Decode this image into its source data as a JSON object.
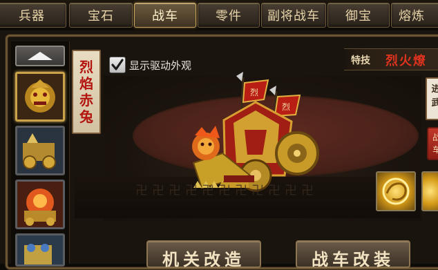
{
  "tabs": [
    {
      "label": "兵器"
    },
    {
      "label": "宝石"
    },
    {
      "label": "战车"
    },
    {
      "label": "零件"
    },
    {
      "label": "副将战车"
    },
    {
      "label": "御宝"
    },
    {
      "label": "熔炼"
    }
  ],
  "active_tab": "战车",
  "vehicle_name": [
    "烈",
    "焰",
    "赤",
    "兔"
  ],
  "show_drive_appearance": {
    "checked": true,
    "label": "显示驱动外观"
  },
  "skill": {
    "label": "特技",
    "name": "烈火燎"
  },
  "side_card": {
    "line1": "进",
    "line2": "武"
  },
  "side_red": {
    "line1": "战",
    "line2": "车"
  },
  "banner_text": "烈",
  "buttons": {
    "left": "机关改造",
    "right": "战车改装"
  },
  "icons": {
    "scroll": "scroll-up-arrow-icon",
    "check": "checkmark-icon",
    "gem": "gold-dragon-gem-icon"
  },
  "colors": {
    "accent": "#c9a24a",
    "skill_red": "#e0331f",
    "name_red": "#b3140f"
  }
}
